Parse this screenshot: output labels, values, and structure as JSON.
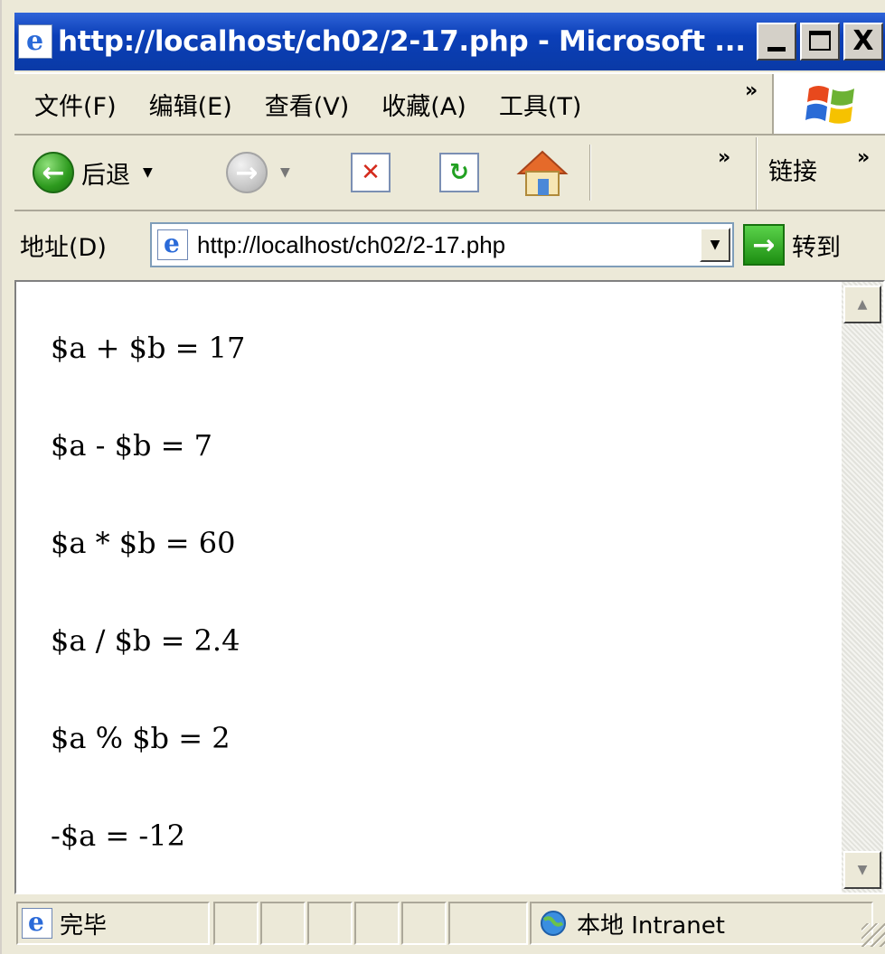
{
  "window": {
    "title": "http://localhost/ch02/2-17.php - Microsoft ...",
    "minimize_glyph": "_",
    "close_glyph": "X"
  },
  "menubar": {
    "items": [
      "文件(F)",
      "编辑(E)",
      "查看(V)",
      "收藏(A)",
      "工具(T)"
    ],
    "overflow": "»"
  },
  "toolbar": {
    "back_label": "后退",
    "overflow": "»",
    "links_label": "链接",
    "links_overflow": "»",
    "icons": [
      "back-icon",
      "forward-icon",
      "stop-icon",
      "refresh-icon",
      "home-icon"
    ]
  },
  "addressbar": {
    "label": "地址(D)",
    "value": "http://localhost/ch02/2-17.php",
    "go_label": "转到"
  },
  "content": {
    "lines": [
      "$a + $b = 17",
      "$a - $b = 7",
      "$a * $b = 60",
      "$a / $b = 2.4",
      "$a % $b = 2",
      "-$a = -12"
    ]
  },
  "statusbar": {
    "status": "完毕",
    "zone": "本地 Intranet"
  },
  "colors": {
    "titlebar": "#0a3aa6",
    "chrome": "#ece9d8",
    "content_bg": "#ffffff"
  }
}
